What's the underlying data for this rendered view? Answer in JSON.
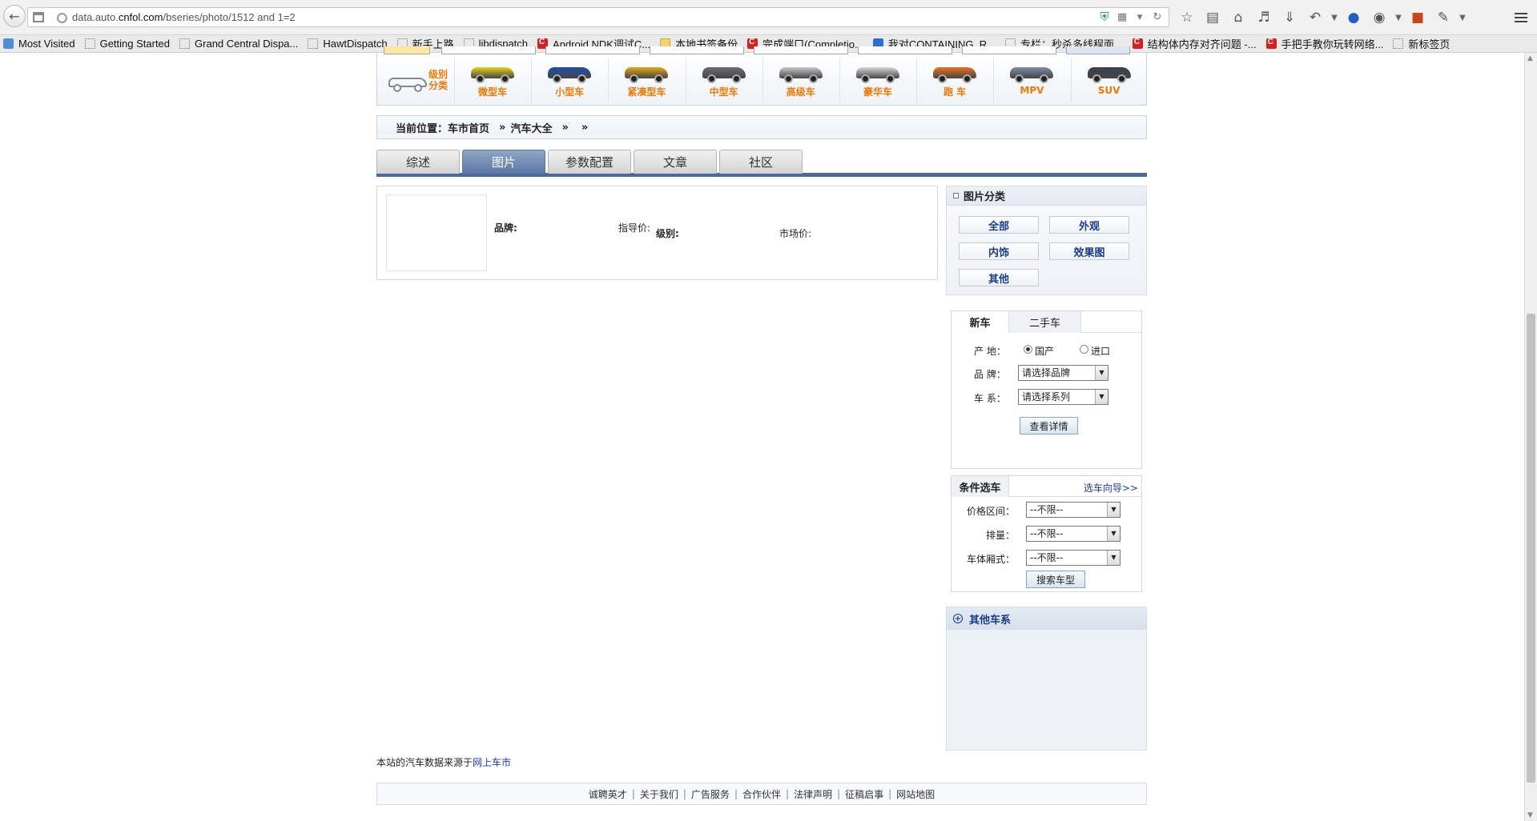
{
  "browser": {
    "url_prefix": "data.auto.",
    "url_host": "cnfol.com",
    "url_path": "/bseries/photo/1512 and 1=2",
    "bookmarks": [
      {
        "label": "Most Visited",
        "icon": "mv"
      },
      {
        "label": "Getting Started",
        "icon": "dotted"
      },
      {
        "label": "Grand Central Dispa...",
        "icon": "dotted"
      },
      {
        "label": "HawtDispatch",
        "icon": "dotted"
      },
      {
        "label": "新手上路",
        "icon": "dotted"
      },
      {
        "label": "libdispatch",
        "icon": "dotted"
      },
      {
        "label": "Android NDK调试C...",
        "icon": "red"
      },
      {
        "label": "本地书签备份",
        "icon": "folder"
      },
      {
        "label": "完成端口(Completio...",
        "icon": "red"
      },
      {
        "label": "我对CONTAINING_R...",
        "icon": "blue"
      },
      {
        "label": "专栏：秒杀多线程面...",
        "icon": "dotted"
      },
      {
        "label": "结构体内存对齐问题 -...",
        "icon": "red"
      },
      {
        "label": "手把手教你玩转网络...",
        "icon": "red"
      },
      {
        "label": "新标签页",
        "icon": "dotted"
      }
    ]
  },
  "category_bar": {
    "label": "级别分类",
    "items": [
      "微型车",
      "小型车",
      "紧凑型车",
      "中型车",
      "高级车",
      "豪华车",
      "跑 车",
      "MPV",
      "SUV"
    ],
    "colors": [
      "#e8d21a",
      "#1f4fae",
      "#e8a61a",
      "#6d6d70",
      "#c9c9cc",
      "#d8d8d8",
      "#f07020",
      "#7d8ea8",
      "#3a4250"
    ]
  },
  "breadcrumb": {
    "prefix": "当前位置：",
    "home": "车市首页",
    "sep1": "»",
    "all": "汽车大全",
    "sep2": "»",
    "sep3": "»"
  },
  "tabs": [
    "综述",
    "图片",
    "参数配置",
    "文章",
    "社区"
  ],
  "active_tab_index": 1,
  "car_info": {
    "brand_label": "品牌:",
    "guide_price_label": "指导价:",
    "level_label": "级别:",
    "market_price_label": "市场价:"
  },
  "image_categories": {
    "title": "图片分类",
    "buttons": [
      "全部",
      "外观",
      "内饰",
      "效果图",
      "其他"
    ]
  },
  "newcar_panel": {
    "tab_new": "新车",
    "tab_used": "二手车",
    "origin_label": "产 地：",
    "origin_domestic": "国产",
    "origin_import": "进口",
    "origin_selected": "国产",
    "brand_label": "品 牌：",
    "brand_select": "请选择品牌",
    "series_label": "车 系：",
    "series_select": "请选择系列",
    "detail_button": "查看详情"
  },
  "condition_panel": {
    "title": "条件选车",
    "guide_link": "选车向导>>",
    "price_label": "价格区间：",
    "price_value": "--不限--",
    "displacement_label": "排量：",
    "displacement_value": "--不限--",
    "body_label": "车体厢式：",
    "body_value": "--不限--",
    "search_button": "搜索车型"
  },
  "other_series": {
    "title": "其他车系"
  },
  "source": {
    "text": "本站的汽车数据来源于",
    "link": "网上车市"
  },
  "footer": {
    "links": [
      "诚聘英才",
      "关于我们",
      "广告服务",
      "合作伙伴",
      "法律声明",
      "征稿启事",
      "网站地图"
    ]
  }
}
